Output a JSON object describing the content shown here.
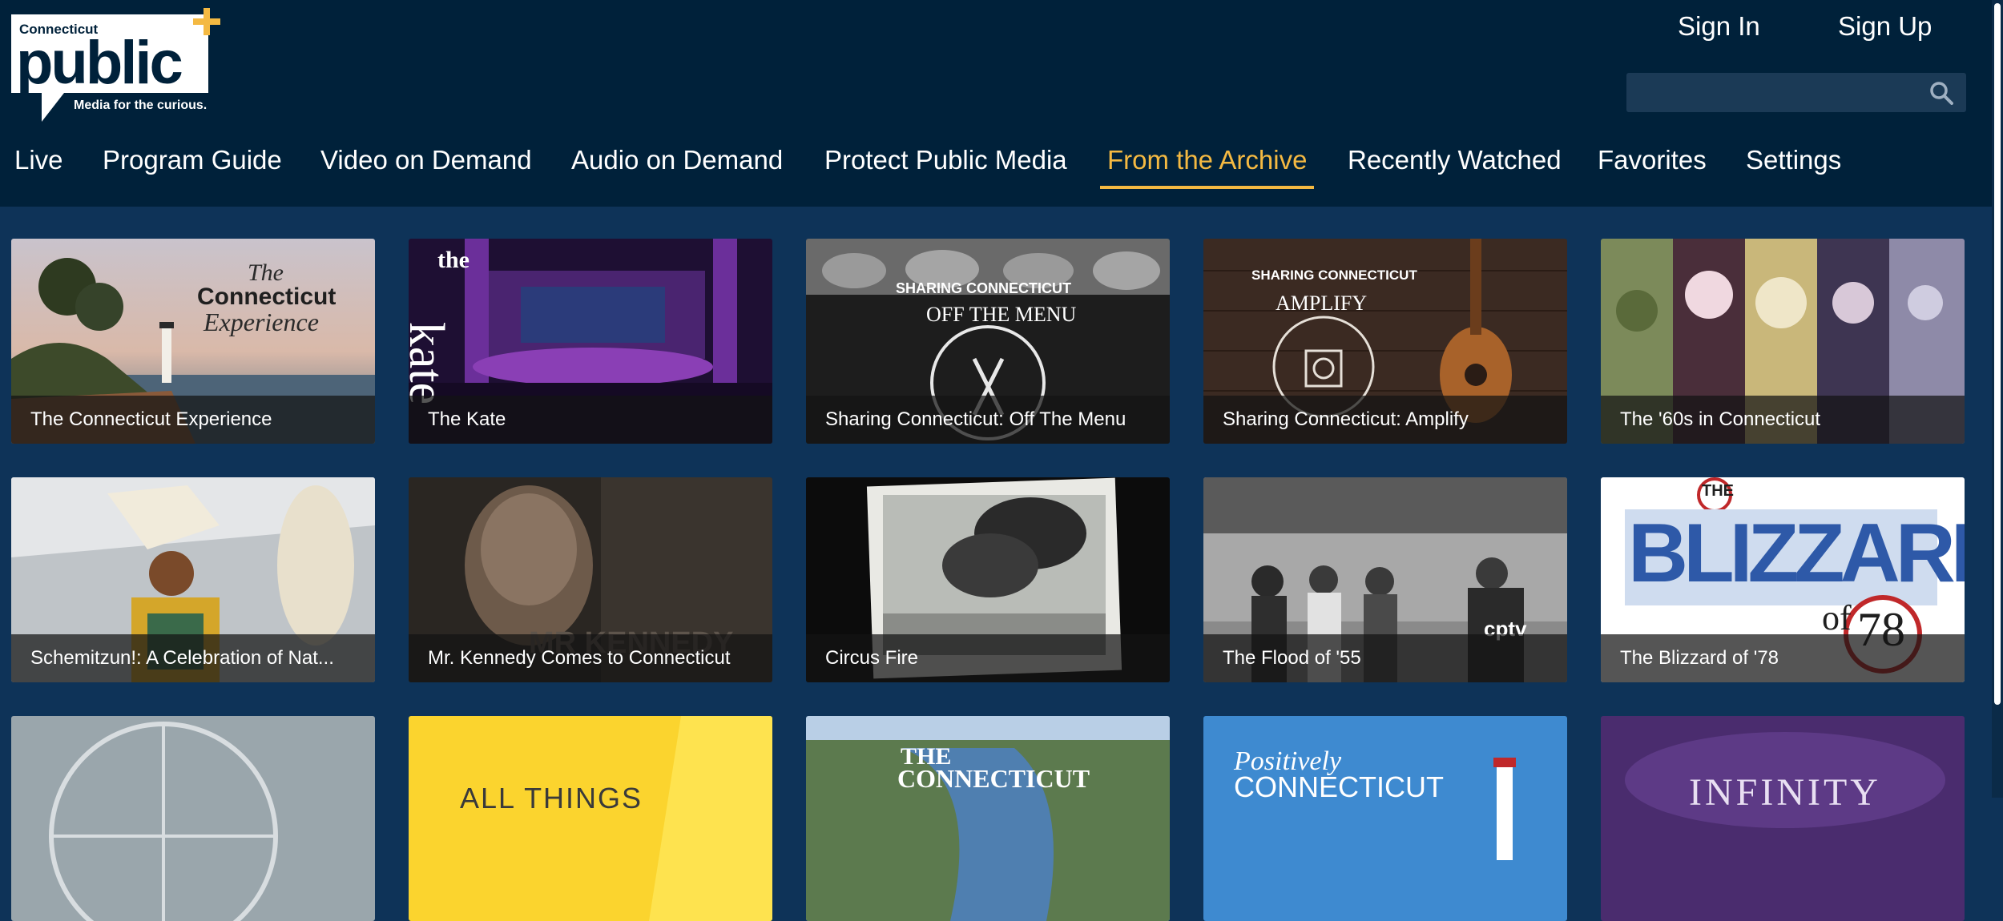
{
  "brand": {
    "logo_top": "Connecticut",
    "logo_main": "public",
    "tagline": "Media for the curious.",
    "accent_color": "#f4b942"
  },
  "auth": {
    "sign_in": "Sign In",
    "sign_up": "Sign Up"
  },
  "search": {
    "placeholder": "",
    "icon": "search-icon"
  },
  "nav": {
    "items": [
      {
        "label": "Live"
      },
      {
        "label": "Program Guide"
      },
      {
        "label": "Video on Demand"
      },
      {
        "label": "Audio on Demand"
      },
      {
        "label": "Protect Public Media"
      },
      {
        "label": "From the Archive",
        "active": true
      },
      {
        "label": "Recently Watched"
      },
      {
        "label": "Favorites"
      },
      {
        "label": "Settings"
      }
    ]
  },
  "cards": [
    {
      "title": "The Connecticut Experience",
      "art_text": [
        "The",
        "Connecticut",
        "Experience"
      ]
    },
    {
      "title": "The Kate",
      "art_text": [
        "the",
        "kate"
      ]
    },
    {
      "title": "Sharing Connecticut: Off The Menu",
      "art_text": [
        "SHARING CONNECTICUT",
        "OFF THE MENU"
      ]
    },
    {
      "title": "Sharing Connecticut: Amplify",
      "art_text": [
        "SHARING CONNECTICUT",
        "AMPLIFY"
      ]
    },
    {
      "title": "The '60s in Connecticut",
      "art_text": []
    },
    {
      "title": "Schemitzun!: A Celebration of Nat...",
      "art_text": []
    },
    {
      "title": "Mr. Kennedy Comes to Connecticut",
      "art_text": [
        "MR KENNEDY"
      ]
    },
    {
      "title": "Circus Fire",
      "art_text": []
    },
    {
      "title": "The Flood of '55",
      "art_text": [
        "cptv"
      ]
    },
    {
      "title": "The Blizzard of '78",
      "art_text": [
        "THE",
        "BLIZZARD",
        "of",
        "78"
      ]
    },
    {
      "title": "",
      "art_text": []
    },
    {
      "title": "",
      "art_text": [
        "ALL THINGS"
      ]
    },
    {
      "title": "",
      "art_text": [
        "THE",
        "CONNECTICUT"
      ]
    },
    {
      "title": "",
      "art_text": [
        "Positively",
        "CONNECTICUT"
      ]
    },
    {
      "title": "",
      "art_text": [
        "INFINITY"
      ]
    }
  ]
}
